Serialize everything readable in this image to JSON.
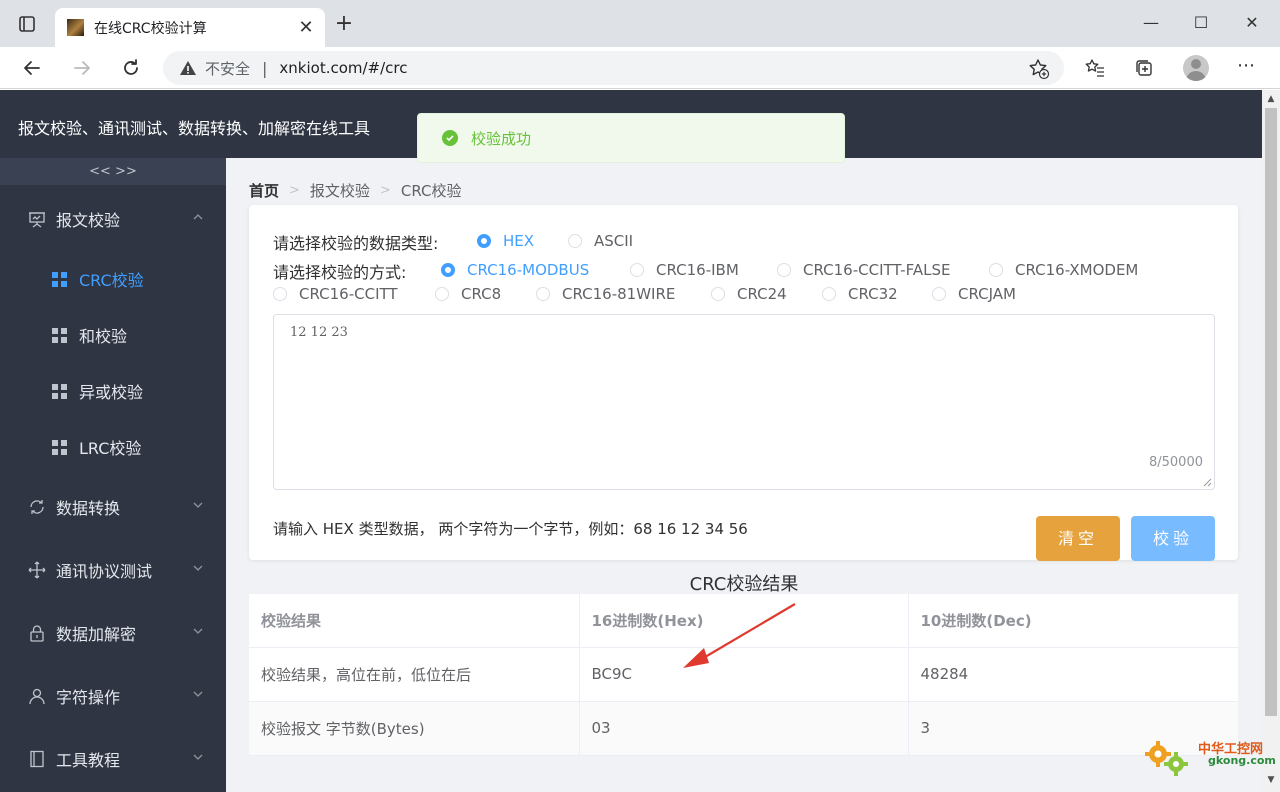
{
  "browser": {
    "tab_title": "在线CRC校验计算",
    "tab_close": "✕",
    "new_tab": "+",
    "minimize": "—",
    "maximize": "☐",
    "close": "✕",
    "security_label": "不安全",
    "separator": "|",
    "url": "xnkiot.com/#/crc",
    "more": "⋯"
  },
  "site": {
    "title": "报文校验、通讯测试、数据转换、加解密在线工具"
  },
  "toast": {
    "message": "校验成功",
    "color": "#67c23a"
  },
  "sidebar": {
    "collapse_label": "<< >>",
    "groups": [
      {
        "label": "报文校验",
        "icon": "presentation-icon",
        "expanded": true
      },
      {
        "label": "数据转换",
        "icon": "refresh-icon"
      },
      {
        "label": "通讯协议测试",
        "icon": "move-icon"
      },
      {
        "label": "数据加解密",
        "icon": "lock-icon"
      },
      {
        "label": "字符操作",
        "icon": "user-icon"
      },
      {
        "label": "工具教程",
        "icon": "book-icon"
      }
    ],
    "sub_items": [
      {
        "label": "CRC校验",
        "active": true
      },
      {
        "label": "和校验"
      },
      {
        "label": "异或校验"
      },
      {
        "label": "LRC校验"
      }
    ],
    "active_color": "#409eff",
    "background": "#2f3542"
  },
  "breadcrumb": {
    "home": "首页",
    "section": "报文校验",
    "current": "CRC校验",
    "separator": ">"
  },
  "form": {
    "data_type_label": "请选择校验的数据类型:",
    "data_types": [
      "HEX",
      "ASCII"
    ],
    "selected_data_type": "HEX",
    "method_label": "请选择校验的方式:",
    "methods": [
      "CRC16-MODBUS",
      "CRC16-IBM",
      "CRC16-CCITT-FALSE",
      "CRC16-XMODEM",
      "CRC16-CCITT",
      "CRC8",
      "CRC16-81WIRE",
      "CRC24",
      "CRC32",
      "CRCJAM"
    ],
    "selected_method": "CRC16-MODBUS",
    "input_value": "12 12 23",
    "char_count": "8/50000",
    "hint": "请输入 HEX 类型数据， 两个字符为一个字节，例如：68 16 12 34 56",
    "clear_button": "清空",
    "verify_button": "校验"
  },
  "result": {
    "title": "CRC校验结果",
    "headers": [
      "校验结果",
      "16进制数(Hex)",
      "10进制数(Dec)"
    ],
    "rows": [
      [
        "校验结果，高位在前，低位在后",
        "BC9C",
        "48284"
      ],
      [
        "校验报文 字节数(Bytes)",
        "03",
        "3"
      ]
    ]
  },
  "watermark": {
    "line1": "中华工控网",
    "line2": "gkong.com"
  }
}
